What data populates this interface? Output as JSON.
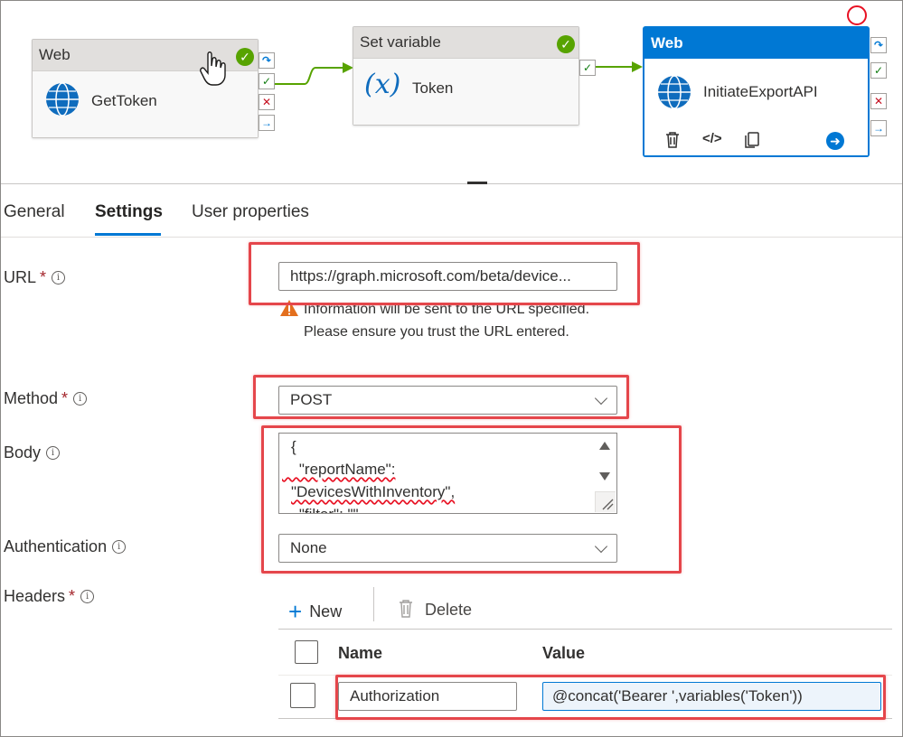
{
  "pipeline": {
    "nodes": [
      {
        "type_label": "Web",
        "name": "GetToken"
      },
      {
        "type_label": "Set variable",
        "name": "Token",
        "icon_text": "(x)"
      },
      {
        "type_label": "Web",
        "name": "InitiateExportAPI"
      }
    ]
  },
  "tabs": [
    {
      "label": "General"
    },
    {
      "label": "Settings"
    },
    {
      "label": "User properties"
    }
  ],
  "active_tab": "Settings",
  "form": {
    "url": {
      "label": "URL",
      "required_mark": "*",
      "value": "https://graph.microsoft.com/beta/device...",
      "warning": "Information will be sent to the URL specified. Please ensure you trust the URL entered."
    },
    "method": {
      "label": "Method",
      "required_mark": "*",
      "value": "POST"
    },
    "body": {
      "label": "Body",
      "lines": [
        "{",
        "    \"reportName\":",
        "\"DevicesWithInventory\",",
        "    \"filter\": \"\""
      ]
    },
    "authentication": {
      "label": "Authentication",
      "value": "None"
    },
    "headers": {
      "label": "Headers",
      "required_mark": "*",
      "new_label": "New",
      "delete_label": "Delete",
      "columns": [
        "Name",
        "Value"
      ],
      "rows": [
        {
          "name": "Authorization",
          "value": "@concat('Bearer ',variables('Token'))"
        }
      ]
    }
  },
  "icons": {
    "info": "info-icon",
    "globe": "globe-icon",
    "check": "check-icon",
    "warning": "warning-icon",
    "chevron": "chevron-down-icon",
    "add": "add-icon",
    "delete": "trash-icon",
    "code": "code-icon",
    "copy": "copy-icon",
    "arrow": "arrow-right-icon",
    "cursor": "hand-cursor-icon"
  },
  "colors": {
    "accent": "#0078d4",
    "success": "#57a300",
    "error": "#c50f1f",
    "highlight": "#e5464b"
  }
}
